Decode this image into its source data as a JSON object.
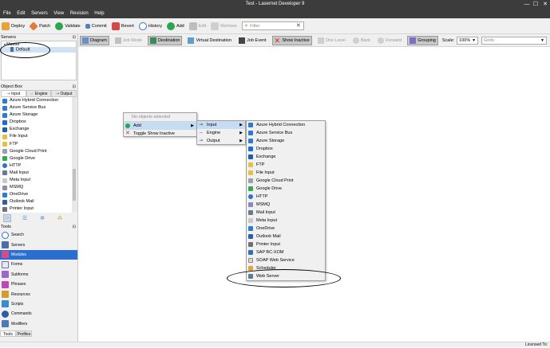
{
  "window": {
    "title": "Test - Lasernet Developer 9",
    "minimize": "—",
    "maximize": "☐",
    "close": "✕"
  },
  "menu": [
    "File",
    "Edit",
    "Servers",
    "View",
    "Revision",
    "Help"
  ],
  "toolbar": {
    "deploy": "Deploy",
    "patch": "Patch",
    "validate": "Validate",
    "commit": "Commit",
    "revert": "Revert",
    "history": "History",
    "add": "Add",
    "edit": "Edit",
    "remove": "Remove",
    "filter_placeholder": "Filter",
    "filter_clear": "✕"
  },
  "toolbar2": {
    "diagram": "Diagram",
    "job_mode": "Job Mode",
    "destination": "Destination",
    "virtual_destination": "Virtual Destination",
    "job_event": "Job Event",
    "show_inactive": "Show Inactive",
    "one_level": "One Level",
    "back": "Back",
    "forward": "Forward",
    "grouping": "Grouping",
    "scale_label": "Scale:",
    "scale_value": "100%",
    "grids_value": "Grids"
  },
  "servers": {
    "header": "Servers",
    "master": "Master",
    "default": "Default"
  },
  "object_box": {
    "header": "Object Box",
    "tabs": [
      "Input",
      "Engine",
      "Output"
    ],
    "items": [
      "Azure Hybrid Connection",
      "Azure Service Bus",
      "Azure Storage",
      "Dropbox",
      "Exchange",
      "File Input",
      "FTP",
      "Google Cloud Print",
      "Google Drive",
      "HTTP",
      "Mail Input",
      "Meta Input",
      "MSMQ",
      "OneDrive",
      "Outlook Mail",
      "Printer Input"
    ]
  },
  "tools": {
    "header": "Tools",
    "items": [
      "Search",
      "Servers",
      "Modules",
      "Forms",
      "Subforms",
      "Phrases",
      "Resources",
      "Scripts",
      "Commands",
      "Modifiers"
    ],
    "selected": "Modules"
  },
  "bottom_tabs": [
    "Tools",
    "Profiles"
  ],
  "status": "Licensed To:",
  "context_menu": {
    "no_selection": "No objects selected",
    "add": "Add",
    "toggle": "Toggle Show Inactive"
  },
  "add_menu": [
    "Input",
    "Engine",
    "Output"
  ],
  "input_menu": [
    "Azure Hybrid Connection",
    "Azure Service Bus",
    "Azure Storage",
    "Dropbox",
    "Exchange",
    "FTP",
    "File Input",
    "Google Cloud Print",
    "Google Drive",
    "HTTP",
    "MSMQ",
    "Mail Input",
    "Meta Input",
    "OneDrive",
    "Outlook Mail",
    "Printer Input",
    "SAP BC-XOM",
    "SOAP Web Service",
    "Scheduler",
    "Web Server"
  ]
}
